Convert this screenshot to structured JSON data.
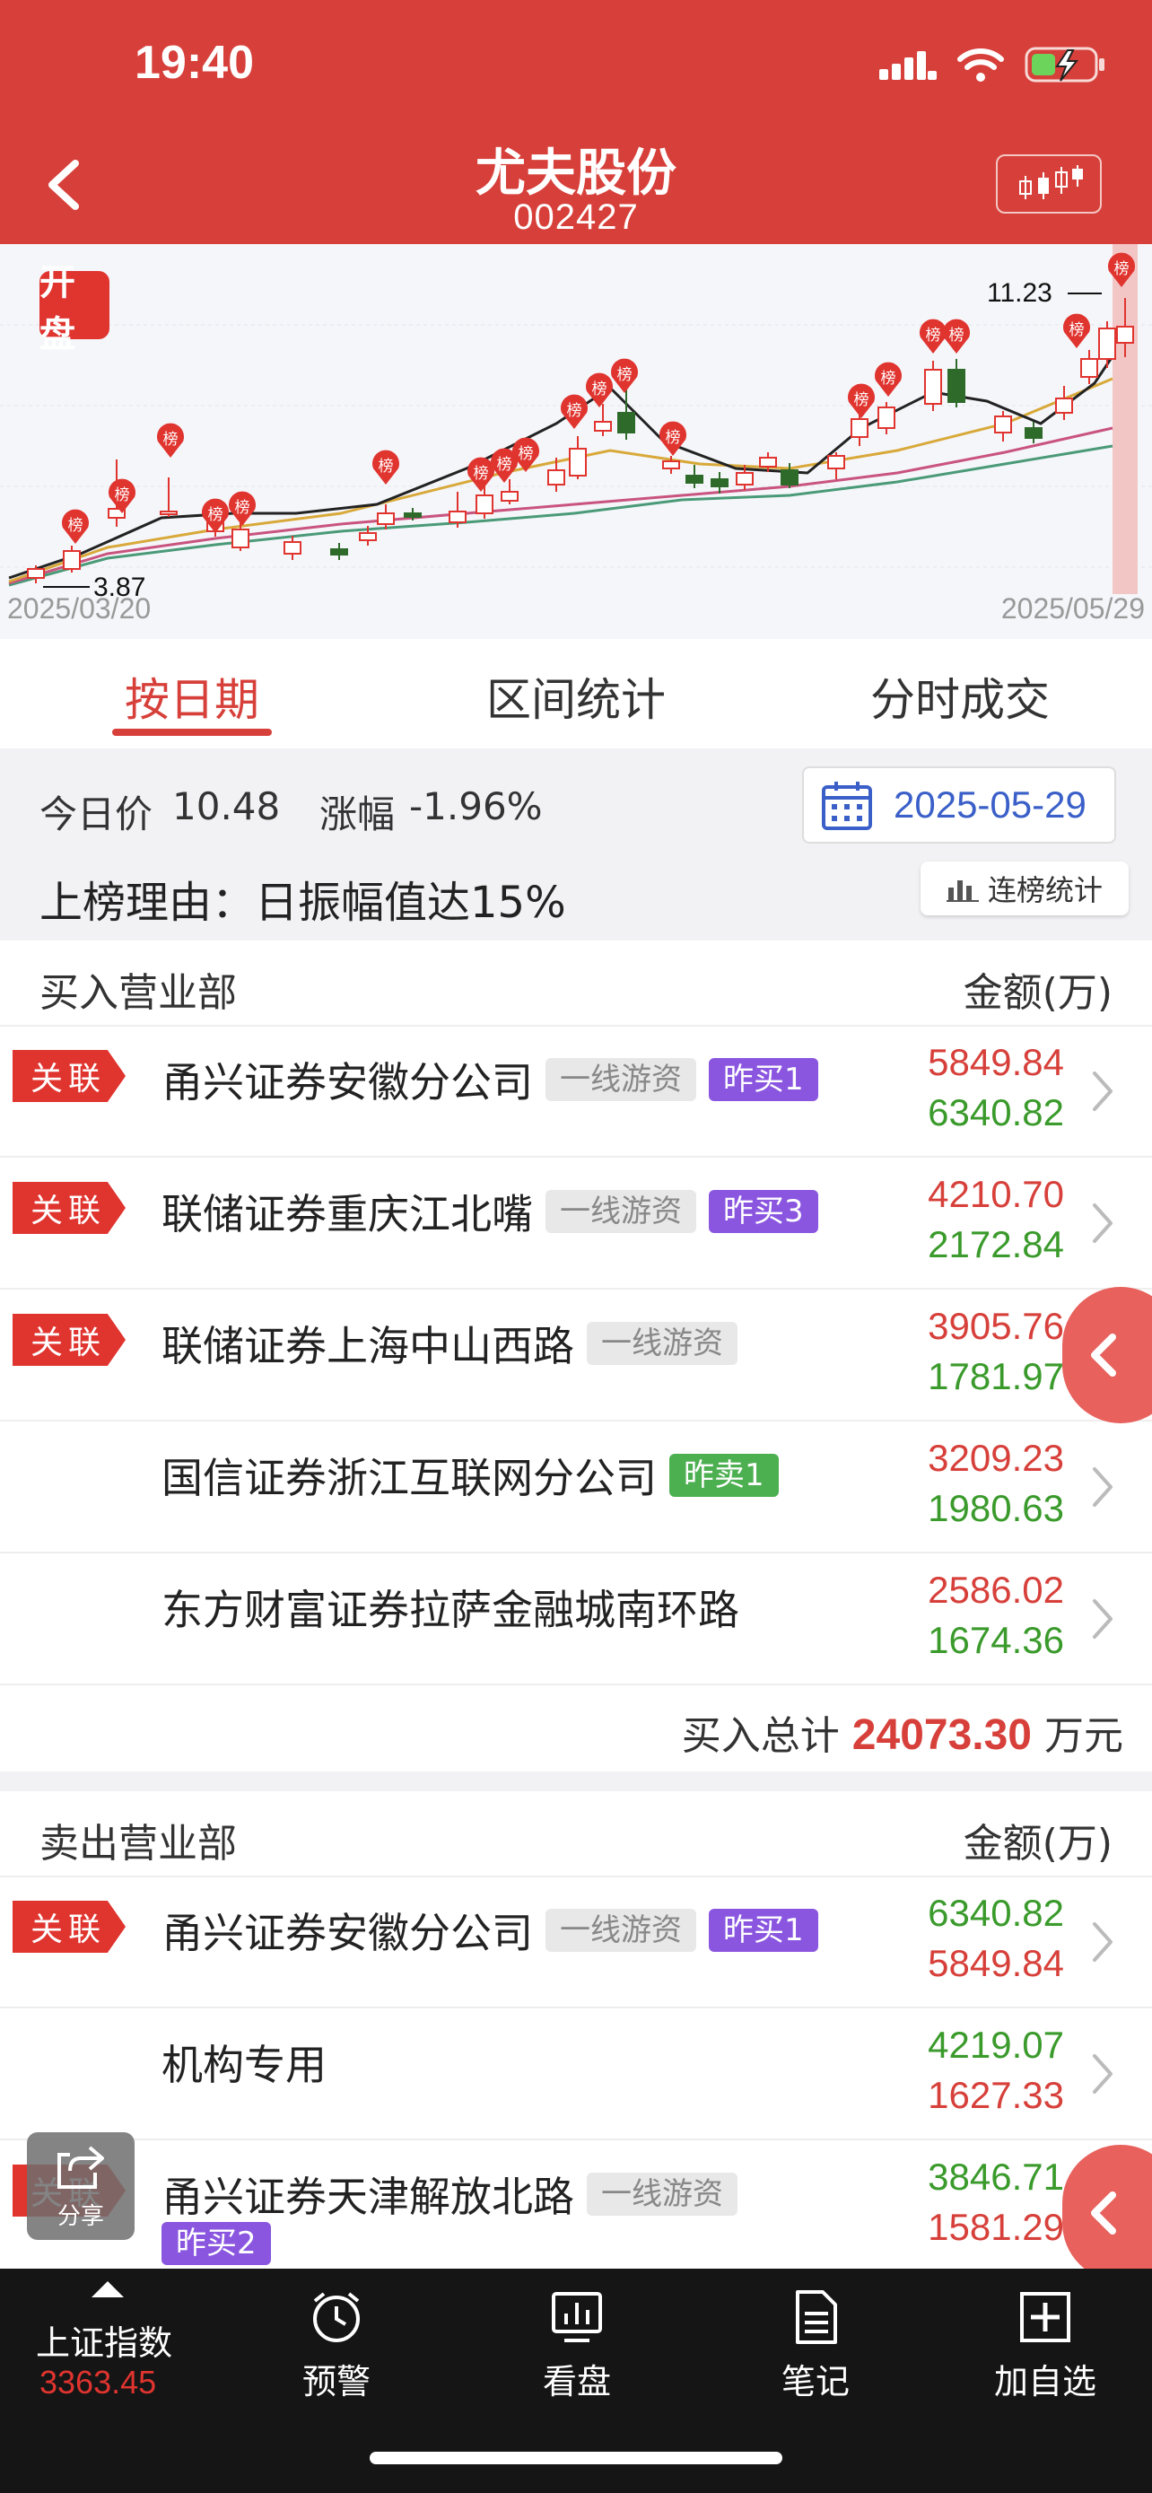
{
  "status": {
    "time": "19:40"
  },
  "header": {
    "title": "尤夫股份",
    "code": "002427"
  },
  "chart": {
    "badge": "开盘",
    "high_label": "11.23",
    "low_label": "3.87",
    "start_date": "2025/03/20",
    "end_date": "2025/05/29",
    "marker_text": "榜"
  },
  "tabs": [
    {
      "label": "按日期",
      "active": true
    },
    {
      "label": "区间统计",
      "active": false
    },
    {
      "label": "分时成交",
      "active": false
    }
  ],
  "price": {
    "today_label": "今日价",
    "today_value": "10.48",
    "change_label": "涨幅",
    "change_value": "-1.96%",
    "date": "2025-05-29"
  },
  "reason": {
    "text": "上榜理由：日振幅值达15%",
    "stat_button": "连榜统计"
  },
  "buy": {
    "header": "买入营业部",
    "amount_header": "金额(万)",
    "rows": [
      {
        "tag": "关联",
        "name": "甬兴证券安徽分公司",
        "badges": [
          {
            "text": "一线游资",
            "style": "gray"
          },
          {
            "text": "昨买1",
            "style": "purple"
          }
        ],
        "v1": "5849.84",
        "v2": "6340.82"
      },
      {
        "tag": "关联",
        "name": "联储证券重庆江北嘴",
        "badges": [
          {
            "text": "一线游资",
            "style": "gray"
          },
          {
            "text": "昨买3",
            "style": "purple"
          }
        ],
        "v1": "4210.70",
        "v2": "2172.84"
      },
      {
        "tag": "关联",
        "name": "联储证券上海中山西路",
        "badges": [
          {
            "text": "一线游资",
            "style": "gray"
          }
        ],
        "v1": "3905.76",
        "v2": "1781.97"
      },
      {
        "tag": "",
        "name": "国信证券浙江互联网分公司",
        "badges": [
          {
            "text": "昨卖1",
            "style": "green"
          }
        ],
        "v1": "3209.23",
        "v2": "1980.63"
      },
      {
        "tag": "",
        "name": "东方财富证券拉萨金融城南环路",
        "badges": [],
        "v1": "2586.02",
        "v2": "1674.36"
      }
    ],
    "total_label": "买入总计",
    "total_value": "24073.30",
    "total_unit": "万元"
  },
  "sell": {
    "header": "卖出营业部",
    "amount_header": "金额(万)",
    "rows": [
      {
        "tag": "关联",
        "name": "甬兴证券安徽分公司",
        "badges": [
          {
            "text": "一线游资",
            "style": "gray"
          },
          {
            "text": "昨买1",
            "style": "purple"
          }
        ],
        "v1": "6340.82",
        "v2": "5849.84"
      },
      {
        "tag": "",
        "name": "机构专用",
        "badges": [],
        "v1": "4219.07",
        "v2": "1627.33"
      },
      {
        "tag": "关联",
        "name": "甬兴证券天津解放北路",
        "badges": [
          {
            "text": "一线游资",
            "style": "gray"
          }
        ],
        "badge2": "昨买2",
        "v1": "3846.71",
        "v2": "1581.29"
      }
    ]
  },
  "share_label": "分享",
  "bottom": {
    "index_name": "上证指数",
    "index_value": "3363.45",
    "items": [
      "预警",
      "看盘",
      "笔记",
      "加自选"
    ]
  },
  "colors": {
    "brand_red": "#d7403a",
    "up": "#d7403a",
    "down": "#3a9a2b",
    "purple": "#8a56e0"
  }
}
